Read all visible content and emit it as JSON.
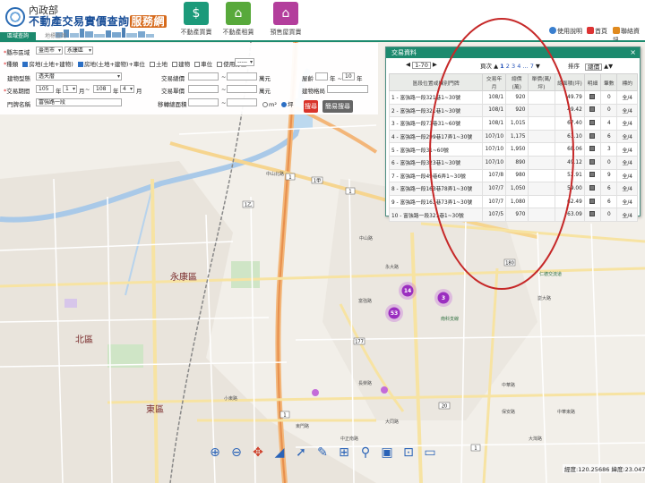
{
  "header": {
    "ministry": "內政部",
    "site_title_prefix": "不動產交易實價查詢",
    "site_title_highlight": "服務網",
    "tabs": [
      {
        "label": "不動產買賣",
        "icon": "building-dollar-icon",
        "color": "#1c9a7a"
      },
      {
        "label": "不動產租賃",
        "icon": "house-icon",
        "color": "#58a93b"
      },
      {
        "label": "預售屋買賣",
        "icon": "crane-icon",
        "color": "#b33e9c"
      }
    ],
    "subnav": [
      "區域查詢",
      "地標查詢"
    ],
    "links": {
      "help": "使用說明",
      "home": "首頁",
      "contact": "聯絡資訊"
    }
  },
  "filters": {
    "city_label": "縣市區域",
    "city": "臺南市",
    "district": "永康區",
    "type_label": "種類",
    "types": [
      {
        "label": "房地(土地+建物)",
        "checked": true
      },
      {
        "label": "房地(土地+建物)+車位",
        "checked": true
      },
      {
        "label": "土地",
        "checked": false
      },
      {
        "label": "建物",
        "checked": false
      },
      {
        "label": "車位",
        "checked": false
      },
      {
        "label": "使用分區",
        "checked": false
      }
    ],
    "zoning_select": "-----",
    "building_type_label": "建物型態",
    "building_type": "透天厝",
    "period_label": "交易期間",
    "from_year": "105",
    "from_month": "1",
    "to_year": "108",
    "to_month": "4",
    "year_unit": "年",
    "month_unit": "月",
    "range_sep": "~",
    "road_label": "門牌名稱",
    "road": "富強路一段",
    "total_price_label": "交易總價",
    "unit_price_label": "交易單價",
    "price_unit": "萬元",
    "area_label": "移轉總面積",
    "area_units": [
      "m²",
      "坪"
    ],
    "age_label": "屋齡",
    "age_from": "",
    "age_to": "10",
    "age_unit": "年",
    "age_sep": "年 ~",
    "structure_label": "建物格局",
    "search_button": "搜尋",
    "advanced_button": "簡易搜尋"
  },
  "dialog": {
    "title": "交易資料",
    "range_select": "1-70",
    "page_label_prefix": "頁次",
    "pages": [
      "1",
      "2",
      "3",
      "4",
      "...",
      "7"
    ],
    "sort_label": "排序",
    "sort_select": "總價",
    "columns": [
      "區段位置或棟別門牌",
      "交易年月",
      "總價(萬)",
      "單價(萬/坪)",
      "總面積(坪)",
      "明細",
      "筆數",
      "標的"
    ],
    "rows": [
      [
        "1 - 富強路一段321巷1~30號",
        "108/1",
        "920",
        "",
        "49.79",
        "",
        "0",
        "全/4"
      ],
      [
        "2 - 富強路一段321巷1~30號",
        "108/1",
        "920",
        "",
        "49.42",
        "",
        "0",
        "全/4"
      ],
      [
        "3 - 富強路一段73巷31~60號",
        "108/1",
        "1,015",
        "",
        "67.40",
        "",
        "4",
        "全/4"
      ],
      [
        "4 - 富強路一段299巷17弄1~30號",
        "107/10",
        "1,175",
        "",
        "63.10",
        "",
        "6",
        "全/4"
      ],
      [
        "5 - 富強路一段31~60號",
        "107/10",
        "1,950",
        "",
        "68.06",
        "",
        "3",
        "全/4"
      ],
      [
        "6 - 富強路一段323巷1~30號",
        "107/10",
        "890",
        "",
        "49.12",
        "",
        "0",
        "全/4"
      ],
      [
        "7 - 富強路一段49巷6弄1~30號",
        "107/8",
        "980",
        "",
        "52.91",
        "",
        "9",
        "全/4"
      ],
      [
        "8 - 富強路一段163巷78弄1~30號",
        "107/7",
        "1,050",
        "",
        "59.00",
        "",
        "6",
        "全/4"
      ],
      [
        "9 - 富強路一段163巷73弄1~30號",
        "107/7",
        "1,080",
        "",
        "62.49",
        "",
        "6",
        "全/4"
      ],
      [
        "10 - 富強路一段321巷1~30號",
        "107/5",
        "970",
        "",
        "63.09",
        "",
        "0",
        "全/4"
      ]
    ]
  },
  "map": {
    "districts": [
      "永康區",
      "北區",
      "東區"
    ],
    "roads": [
      "中山北路",
      "中山路",
      "中華路",
      "富強路",
      "小東路",
      "長榮路",
      "大同路",
      "東門路",
      "南科支線",
      "永大路",
      "中正南路",
      "崑大路",
      "大灣路",
      "保安路",
      "仁德交流道",
      "中華東路"
    ],
    "clusters": [
      "14",
      "3",
      "53"
    ],
    "highway_signs": [
      "1",
      "1甲",
      "1乙",
      "1",
      "180",
      "177",
      "1",
      "20",
      "1"
    ]
  },
  "toolbar": [
    "zoom-in-icon",
    "zoom-out-icon",
    "pan-icon",
    "measure-icon",
    "navigate-icon",
    "marker-icon",
    "fence-icon",
    "pin-icon",
    "layer-icon",
    "grid-icon",
    "street-icon"
  ],
  "coords": {
    "lng_label": "經度:",
    "lng": "120.25686",
    "lat_label": "緯度:",
    "lat": "23.04779"
  }
}
